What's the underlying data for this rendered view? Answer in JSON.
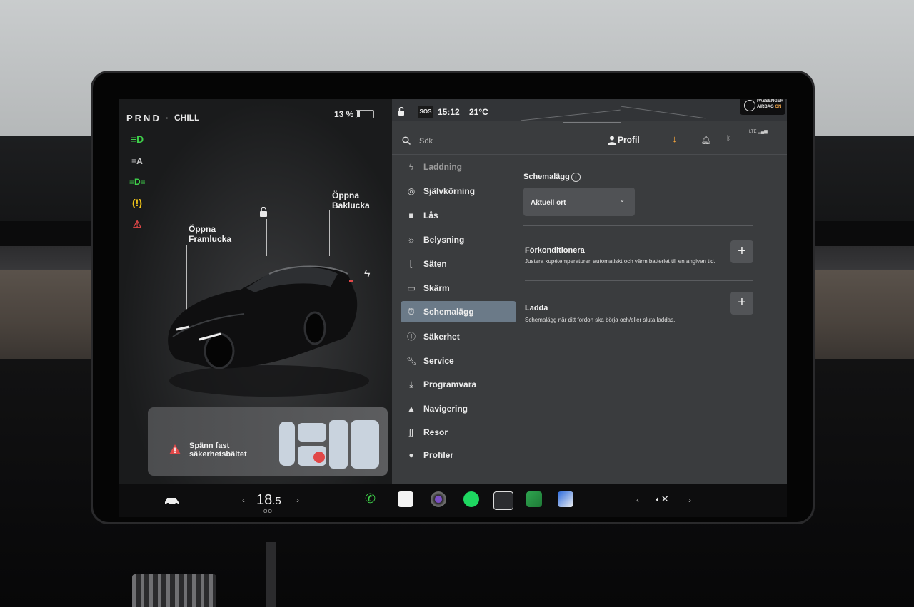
{
  "drive": {
    "gears": "PRND",
    "mode": "CHILL",
    "battery": "13 %"
  },
  "car": {
    "frunk_label_1": "Öppna",
    "frunk_label_2": "Framlucka",
    "trunk_label_1": "Öppna",
    "trunk_label_2": "Baklucka"
  },
  "alert": {
    "line1": "Spänn fast",
    "line2": "säkerhetsbältet"
  },
  "statusbar": {
    "sos": "SOS",
    "time": "15:12",
    "outside_temp": "21°C",
    "airbag_line1": "PASSENGER",
    "airbag_line2": "AIRBAG",
    "airbag_state": "ON"
  },
  "header": {
    "search_placeholder": "Sök",
    "profile": "Profil",
    "lte": "LTE"
  },
  "nav": {
    "items": [
      {
        "label": "Laddning",
        "icon": "bolt-icon"
      },
      {
        "label": "Självkörning",
        "icon": "steering-wheel-icon"
      },
      {
        "label": "Lås",
        "icon": "lock-icon"
      },
      {
        "label": "Belysning",
        "icon": "sun-icon"
      },
      {
        "label": "Säten",
        "icon": "seat-icon"
      },
      {
        "label": "Skärm",
        "icon": "display-icon"
      },
      {
        "label": "Schemalägg",
        "icon": "alarm-clock-icon"
      },
      {
        "label": "Säkerhet",
        "icon": "info-circle-icon"
      },
      {
        "label": "Service",
        "icon": "wrench-icon"
      },
      {
        "label": "Programvara",
        "icon": "download-icon"
      },
      {
        "label": "Navigering",
        "icon": "navigation-arrow-icon"
      },
      {
        "label": "Resor",
        "icon": "trips-icon"
      },
      {
        "label": "Profiler",
        "icon": "person-icon"
      }
    ],
    "active": "Schemalägg"
  },
  "schedule": {
    "title": "Schemalägg",
    "location": "Aktuell ort",
    "precondition_title": "Förkonditionera",
    "precondition_desc": "Justera kupétemperaturen automatiskt och värm batteriet till en angiven tid.",
    "charge_title": "Ladda",
    "charge_desc": "Schemalägg när ditt fordon ska börja och/eller sluta laddas.",
    "plus": "+"
  },
  "dock": {
    "temp_whole": "18",
    "temp_frac": ".5",
    "prev": "‹",
    "next": "›",
    "heat": "ʘʘ"
  },
  "colors": {
    "accent_green": "#3fd24a",
    "warning_red": "#e14848",
    "active_nav": "#6b7a88",
    "download_orange": "#f0a23c"
  }
}
